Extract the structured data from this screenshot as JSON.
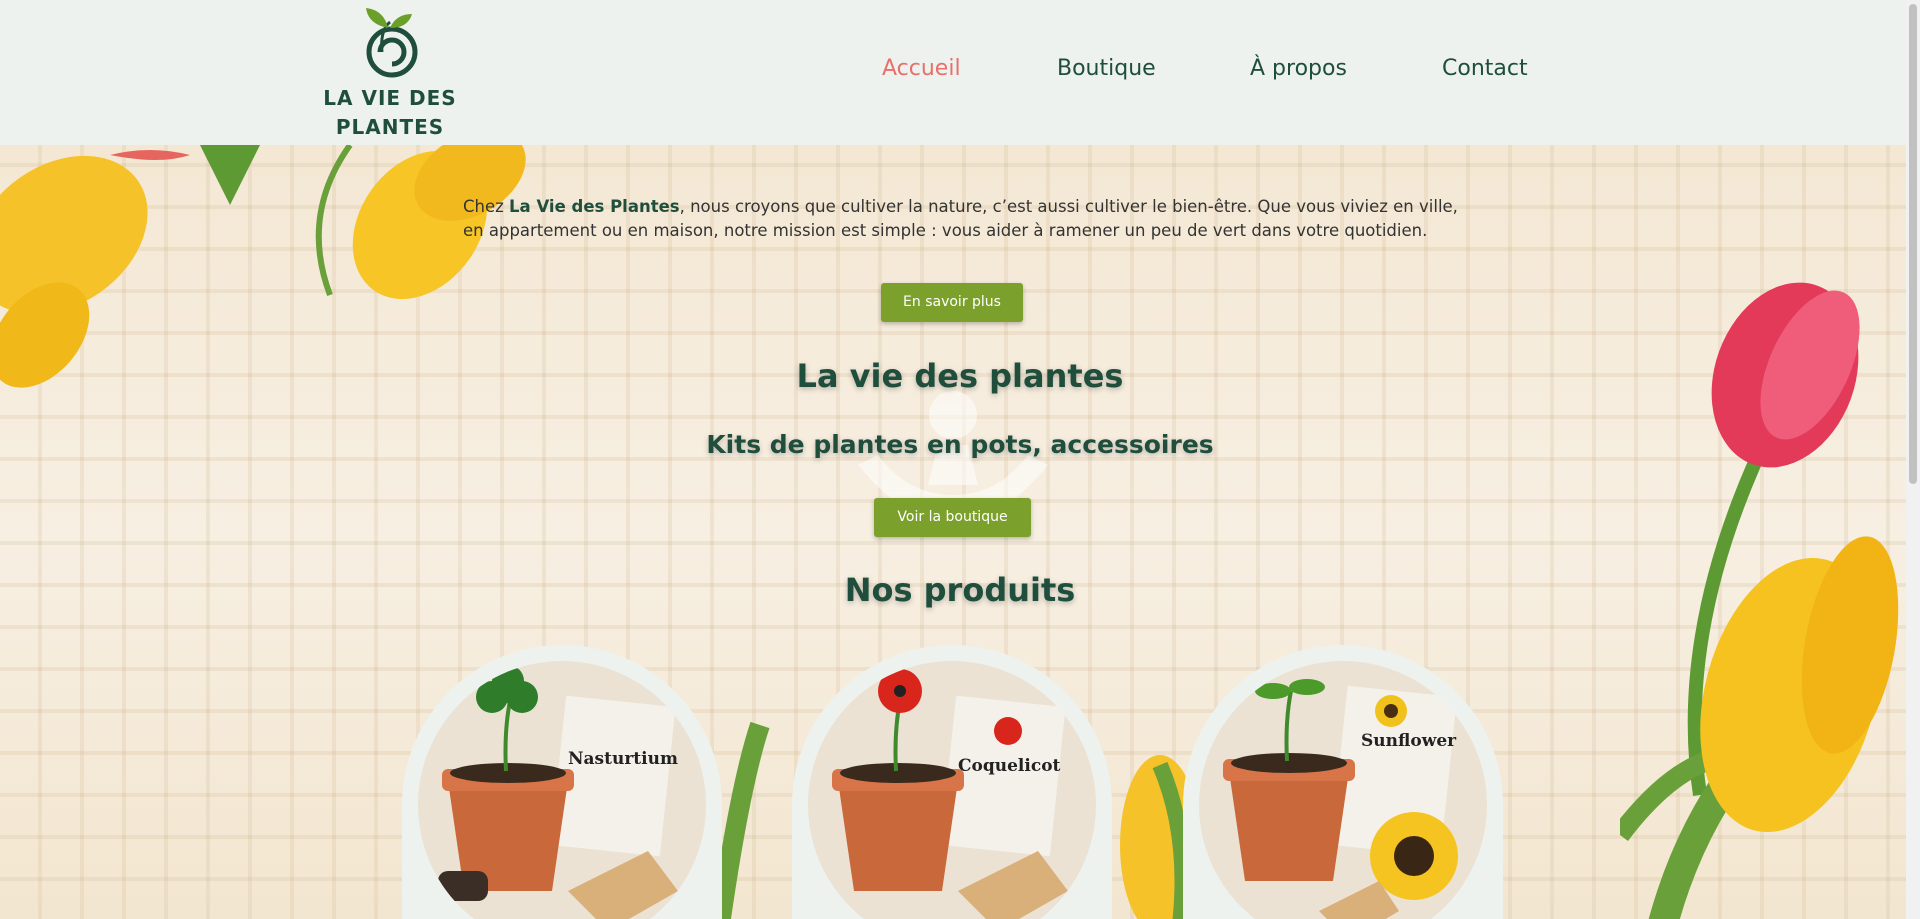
{
  "brand": {
    "name_line1": "LA VIE DES",
    "name_line2": "PLANTES"
  },
  "nav": {
    "items": [
      "Accueil",
      "Boutique",
      "À propos",
      "Contact"
    ],
    "active": "Accueil"
  },
  "hero": {
    "intro_prefix": "Chez ",
    "intro_brand": "La Vie des Plantes",
    "intro_rest": ", nous croyons que cultiver la nature, c’est aussi cultiver le bien-être. Que vous viviez en ville, en appartement ou en maison, notre mission est simple : vous aider à ramener un peu de vert dans votre quotidien.",
    "learn_more_label": "En savoir plus",
    "title": "La vie des plantes",
    "subtitle": "Kits de plantes en pots, accessoires",
    "shop_label": "Voir la boutique",
    "products_title": "Nos produits"
  },
  "products": [
    {
      "name": "Nasturtium"
    },
    {
      "name": "Coquelicot"
    },
    {
      "name": "Sunflower"
    }
  ],
  "colors": {
    "primary": "#1f4e3d",
    "accent": "#e8706a",
    "button": "#7ba02c",
    "header_bg": "#eef2ef"
  }
}
